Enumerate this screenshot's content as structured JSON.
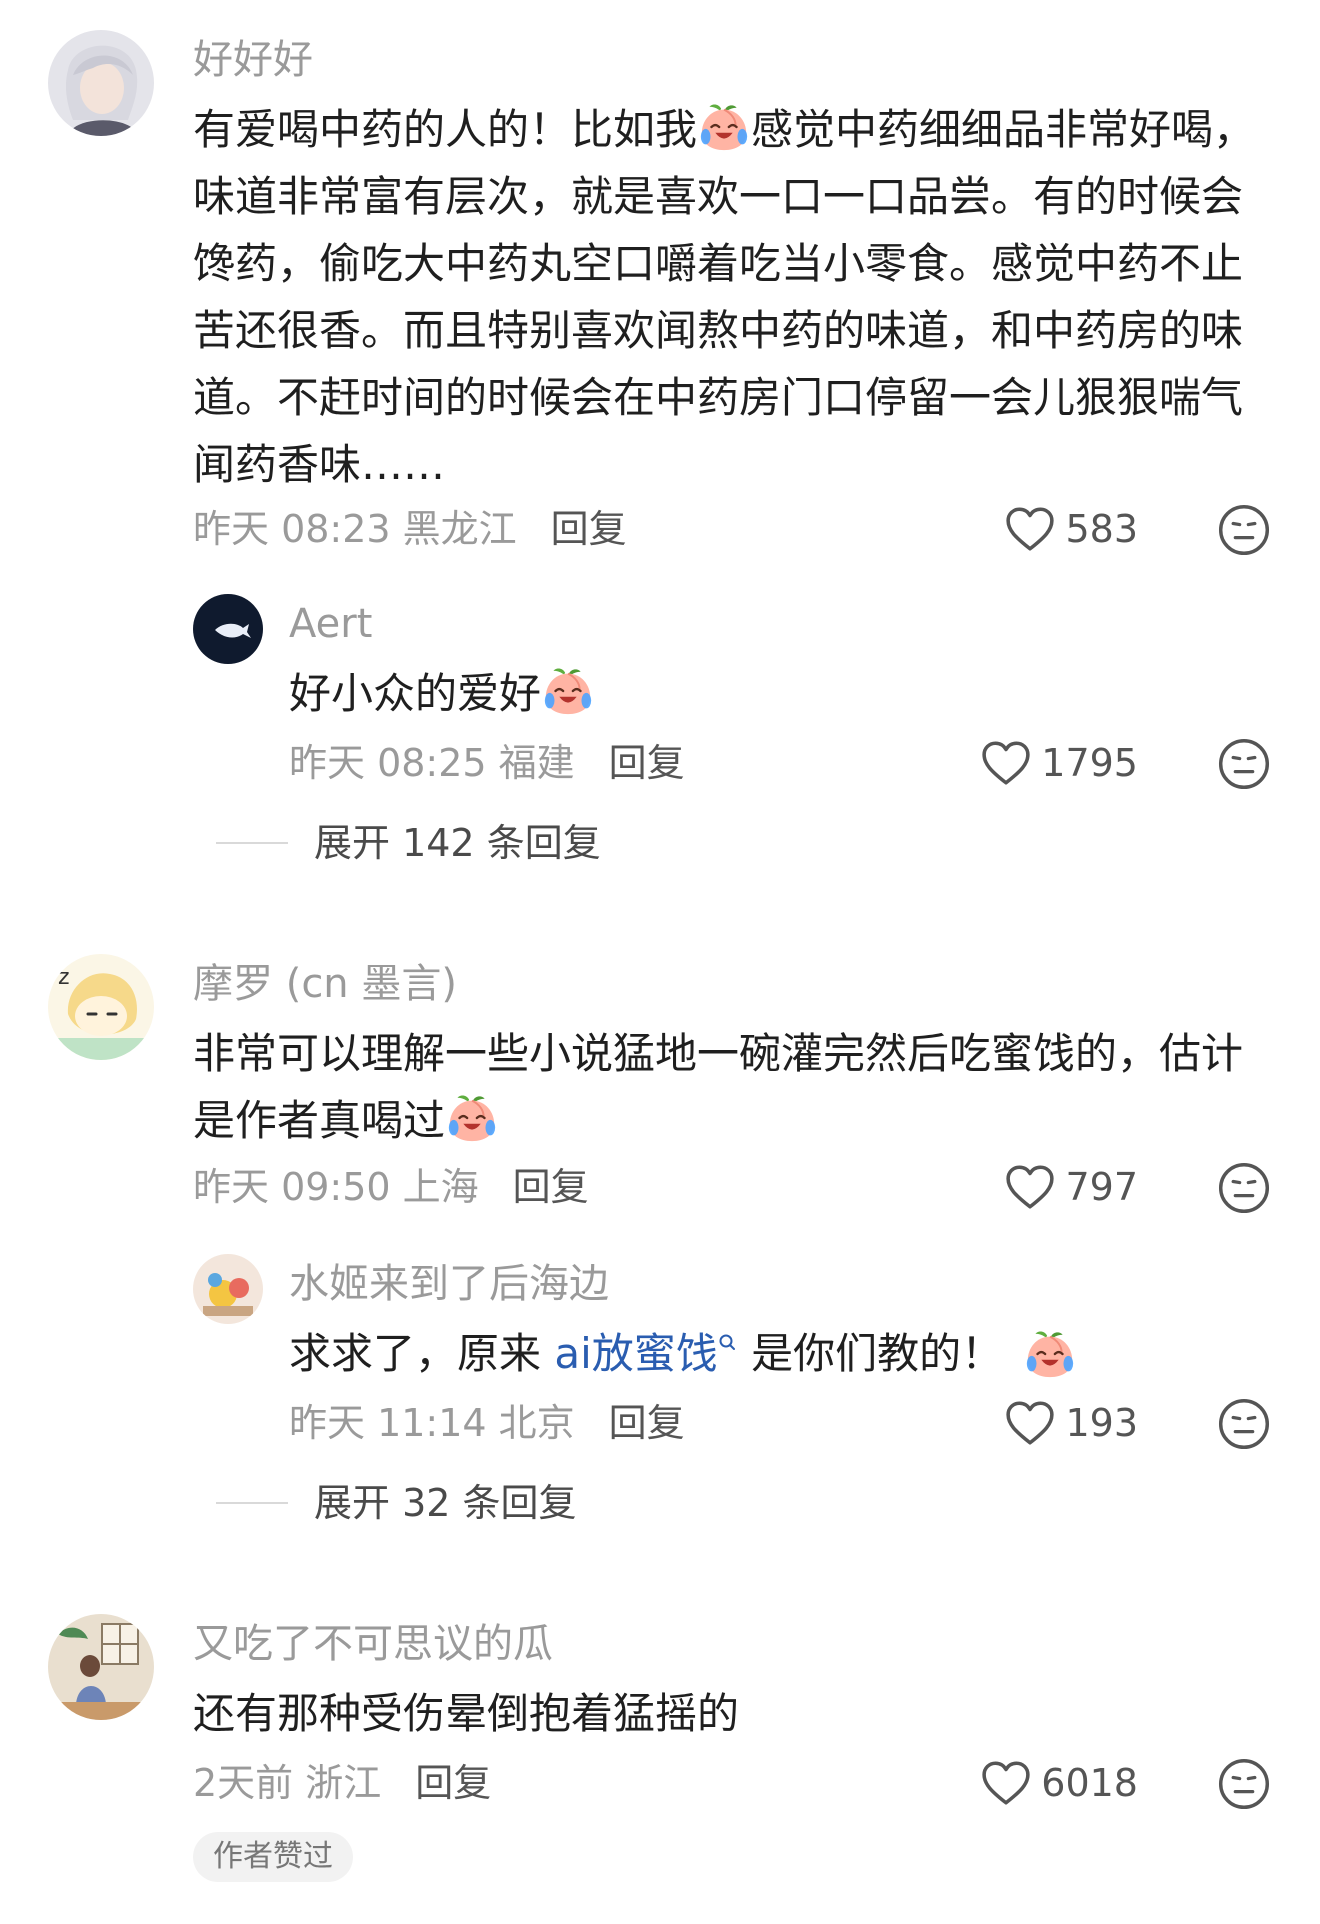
{
  "comments": [
    {
      "user": "好好好",
      "text_lines": [
        "有爱喝中药的人的！比如我",
        "感觉中药细细品非常好喝，",
        "味道非常富有层次，就是喜欢一口一口品尝。有的时候会",
        "馋药，偷吃大中药丸空口嚼着吃当小零食。感觉中药不止",
        "苦还很香。而且特别喜欢闻熬中药的味道，和中药房的味",
        "道。不赶时间的时候会在中药房门口停留一会儿狠狠喘气",
        "闻药香味……"
      ],
      "time": "昨天 08:23 黑龙江",
      "reply_label": "回复",
      "likes": "583",
      "reply": {
        "user": "Aert",
        "text": "好小众的爱好",
        "time": "昨天 08:25 福建",
        "reply_label": "回复",
        "likes": "1795"
      },
      "expand_label": "展开 142 条回复"
    },
    {
      "user": "摩罗 (cn 墨言)",
      "text_lines": [
        "非常可以理解一些小说猛地一碗灌完然后吃蜜饯的，估计",
        "是作者真喝过"
      ],
      "time": "昨天 09:50 上海",
      "reply_label": "回复",
      "likes": "797",
      "reply": {
        "user": "水姬来到了后海边",
        "text_before": "求求了，原来 ",
        "link": "ai放蜜饯",
        "text_after": " 是你们教的！",
        "time": "昨天 11:14 北京",
        "reply_label": "回复",
        "likes": "193"
      },
      "expand_label": "展开 32 条回复"
    },
    {
      "user": "又吃了不可思议的瓜",
      "text": "还有那种受伤晕倒抱着猛摇的",
      "time": "2天前 浙江",
      "reply_label": "回复",
      "likes": "6018",
      "author_badge": "作者赞过"
    }
  ],
  "icons": {
    "like": "heart-outline-icon",
    "dislike": "meh-face-icon",
    "emoji": "crying-laughing-peach-emoji",
    "search": "search-icon"
  },
  "colors": {
    "text": "#1f1f1f",
    "muted": "#9a9a9a",
    "link": "#2a5db0"
  }
}
